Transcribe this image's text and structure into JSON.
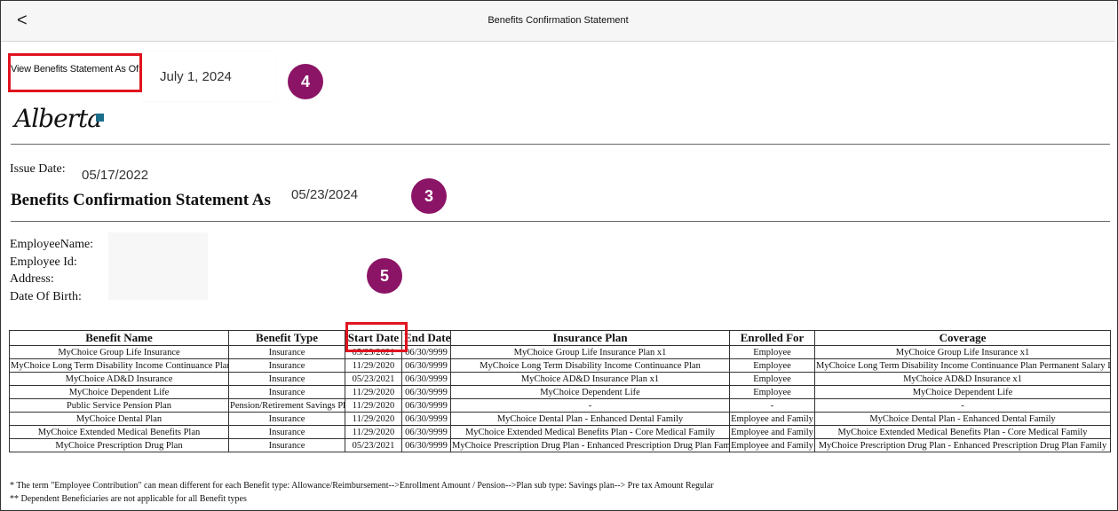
{
  "header": {
    "title": "Benefits Confirmation Statement",
    "back_glyph": "<"
  },
  "statement_selector": {
    "label": "View Benefits Statement As Of:",
    "value": "July 1, 2024"
  },
  "logo": {
    "text": "Alberta"
  },
  "issue": {
    "label": "Issue Date:",
    "value": "05/17/2022"
  },
  "statement": {
    "heading": "Benefits Confirmation Statement As of",
    "date": "05/23/2024"
  },
  "employee": {
    "name_label": "EmployeeName:",
    "id_label": "Employee Id:",
    "address_label": "Address:",
    "dob_label": "Date Of Birth:"
  },
  "markers": {
    "m3": "3",
    "m4": "4",
    "m5": "5"
  },
  "table": {
    "headers": [
      "Benefit Name",
      "Benefit Type",
      "Start Date",
      "End Date",
      "Insurance Plan",
      "Enrolled For",
      "Coverage"
    ],
    "rows": [
      [
        "MyChoice Group Life Insurance",
        "Insurance",
        "05/23/2021",
        "06/30/9999",
        "MyChoice Group Life Insurance Plan x1",
        "Employee",
        "MyChoice Group Life Insurance x1"
      ],
      [
        "MyChoice Long Term Disability Income Continuance Plan",
        "Insurance",
        "11/29/2020",
        "06/30/9999",
        "MyChoice Long Term Disability Income Continuance Plan",
        "Employee",
        "MyChoice Long Term Disability Income Continuance Plan Permanent Salary LTD"
      ],
      [
        "MyChoice AD&D Insurance",
        "Insurance",
        "05/23/2021",
        "06/30/9999",
        "MyChoice AD&D Insurance Plan x1",
        "Employee",
        "MyChoice AD&D Insurance x1"
      ],
      [
        "MyChoice Dependent Life",
        "Insurance",
        "11/29/2020",
        "06/30/9999",
        "MyChoice Dependent Life",
        "Employee",
        "MyChoice Dependent Life"
      ],
      [
        "Public Service Pension Plan",
        "Pension/Retirement Savings Plan",
        "11/29/2020",
        "06/30/9999",
        "-",
        "-",
        "-"
      ],
      [
        "MyChoice Dental Plan",
        "Insurance",
        "11/29/2020",
        "06/30/9999",
        "MyChoice Dental Plan - Enhanced Dental Family",
        "Employee and Family",
        "MyChoice Dental Plan - Enhanced Dental Family"
      ],
      [
        "MyChoice Extended Medical Benefits Plan",
        "Insurance",
        "11/29/2020",
        "06/30/9999",
        "MyChoice Extended Medical Benefits Plan - Core Medical Family",
        "Employee and Family",
        "MyChoice Extended Medical Benefits Plan - Core Medical Family"
      ],
      [
        "MyChoice Prescription Drug Plan",
        "Insurance",
        "05/23/2021",
        "06/30/9999",
        "MyChoice Prescription Drug Plan - Enhanced Prescription Drug Plan Family",
        "Employee and Family",
        "MyChoice Prescription Drug Plan - Enhanced Prescription Drug Plan Family"
      ]
    ]
  },
  "footnotes": [
    "*  The term \"Employee Contribution\" can mean different for each Benefit type: Allowance/Reimbursement-->Enrollment Amount / Pension-->Plan sub type: Savings plan--> Pre tax Amount Regular",
    "** Dependent Beneficiaries are not applicable for all Benefit types"
  ],
  "colors": {
    "marker": "#8b1466",
    "highlight": "#e0141e",
    "logo_square": "#1a6e8a"
  }
}
